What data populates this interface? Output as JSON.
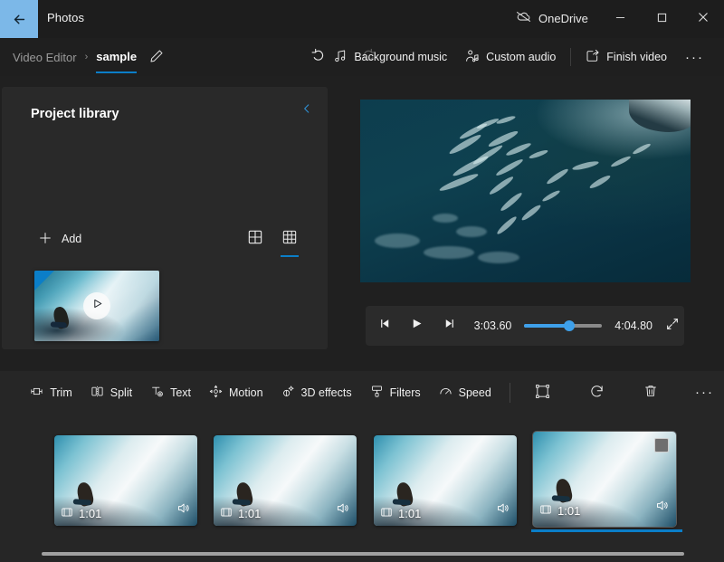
{
  "titlebar": {
    "back_icon": "back-arrow-icon",
    "app_title": "Photos",
    "onedrive_label": "OneDrive",
    "onedrive_icon": "onedrive-cloud-offline-icon",
    "minimize_icon": "minimize-icon",
    "maximize_icon": "maximize-icon",
    "close_icon": "close-icon"
  },
  "commandbar": {
    "breadcrumb_parent": "Video Editor",
    "breadcrumb_separator": "›",
    "breadcrumb_current": "sample",
    "rename_icon": "pencil-edit-icon",
    "undo_icon": "undo-icon",
    "redo_icon": "redo-icon",
    "actions": [
      {
        "label": "Background music",
        "icon": "music-note-icon"
      },
      {
        "label": "Custom audio",
        "icon": "person-audio-icon"
      },
      {
        "label": "Finish video",
        "icon": "share-export-icon"
      }
    ],
    "more_label": "···"
  },
  "library": {
    "title": "Project library",
    "collapse_icon": "chevron-left-icon",
    "add_label": "Add",
    "add_icon": "plus-icon",
    "view_toggles": [
      {
        "icon": "grid-large-icon",
        "selected": false
      },
      {
        "icon": "grid-small-icon",
        "selected": true
      }
    ],
    "card": {
      "play_icon": "play-triangle-icon",
      "thumbnail": "surfer-wave-thumbnail"
    }
  },
  "preview": {
    "description": "aerial-ocean-surfers-frame"
  },
  "player": {
    "prev_frame_icon": "previous-frame-icon",
    "play_icon": "play-icon",
    "next_frame_icon": "next-frame-icon",
    "current_time": "3:03.60",
    "total_time": "4:04.80",
    "progress_percent": 58,
    "expand_icon": "fullscreen-expand-icon",
    "accent_color": "#3ea0ea"
  },
  "storyboard": {
    "toolbar": [
      {
        "label": "Trim",
        "icon": "trim-icon"
      },
      {
        "label": "Split",
        "icon": "split-icon"
      },
      {
        "label": "Text",
        "icon": "text-add-icon"
      },
      {
        "label": "Motion",
        "icon": "motion-icon"
      },
      {
        "label": "3D effects",
        "icon": "3d-effects-icon"
      },
      {
        "label": "Filters",
        "icon": "filters-icon"
      },
      {
        "label": "Speed",
        "icon": "speed-icon"
      }
    ],
    "toolbar_icons": [
      {
        "icon": "aspect-ratio-icon"
      },
      {
        "icon": "rotate-icon"
      },
      {
        "icon": "delete-trash-icon"
      },
      {
        "icon": "more-options-icon"
      }
    ],
    "clips": [
      {
        "duration": "1:01",
        "film_icon": "film-strip-icon",
        "audio_icon": "speaker-icon",
        "selected": false
      },
      {
        "duration": "1:01",
        "film_icon": "film-strip-icon",
        "audio_icon": "speaker-icon",
        "selected": false
      },
      {
        "duration": "1:01",
        "film_icon": "film-strip-icon",
        "audio_icon": "speaker-icon",
        "selected": false
      },
      {
        "duration": "1:01",
        "film_icon": "film-strip-icon",
        "audio_icon": "speaker-icon",
        "selected": true
      }
    ],
    "scrollbar_icon": "horizontal-scrollbar"
  },
  "colors": {
    "accent": "#0b7ec8",
    "slider": "#3ea0ea",
    "back_button_bg": "#7cb8e8",
    "window_bg": "#202020",
    "panel_bg": "#292929",
    "storyboard_bg": "#262626"
  }
}
